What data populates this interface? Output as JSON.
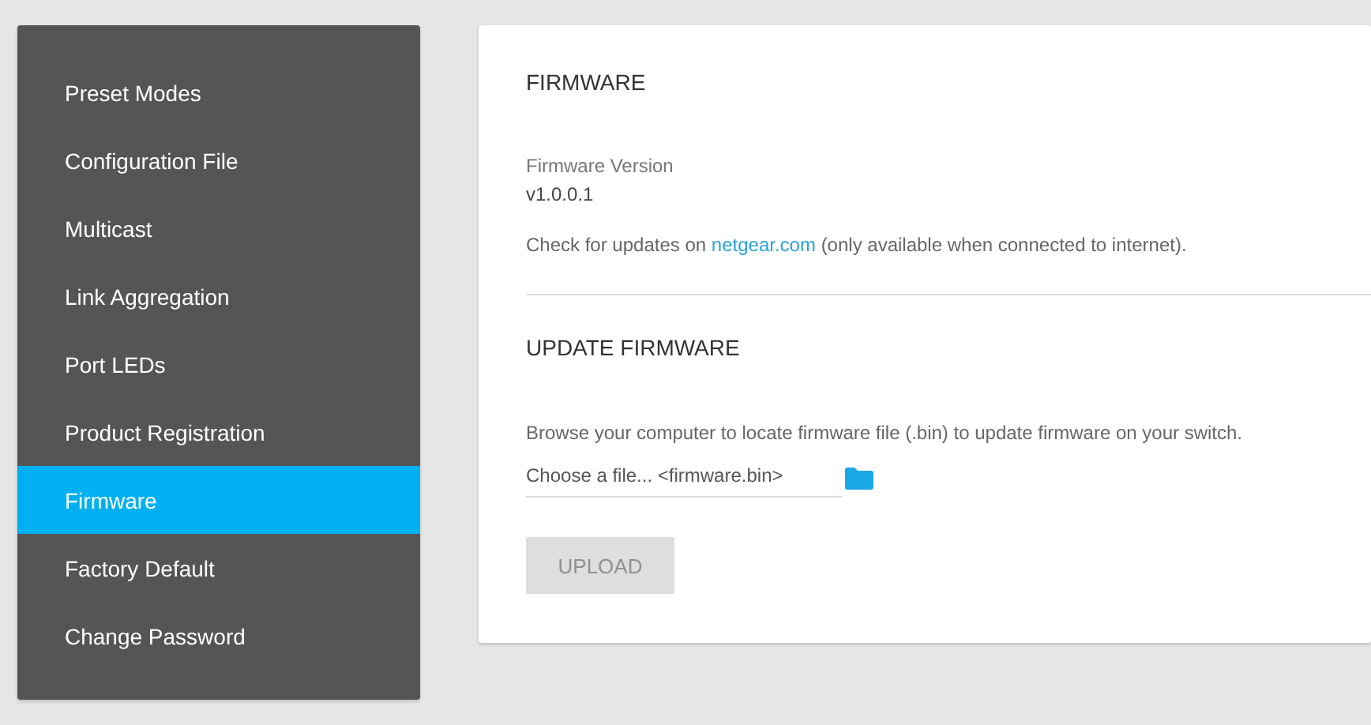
{
  "sidebar": {
    "items": [
      {
        "label": "Preset Modes",
        "selected": false
      },
      {
        "label": "Configuration File",
        "selected": false
      },
      {
        "label": "Multicast",
        "selected": false
      },
      {
        "label": "Link Aggregation",
        "selected": false
      },
      {
        "label": "Port LEDs",
        "selected": false
      },
      {
        "label": "Product Registration",
        "selected": false
      },
      {
        "label": "Firmware",
        "selected": true
      },
      {
        "label": "Factory Default",
        "selected": false
      },
      {
        "label": "Change Password",
        "selected": false
      }
    ]
  },
  "firmware": {
    "title": "FIRMWARE",
    "version_label": "Firmware Version",
    "version": "v1.0.0.1",
    "check_prefix": "Check for updates on",
    "check_link": "netgear.com",
    "check_suffix": "(only available when connected to internet)."
  },
  "update": {
    "title": "UPDATE FIRMWARE",
    "description": "Browse your computer to locate firmware file (.bin) to update firmware on your switch.",
    "file_field": {
      "placeholder": "Choose a file... <firmware.bin>"
    },
    "upload_button": {
      "label": "UPLOAD",
      "disabled": true
    }
  }
}
